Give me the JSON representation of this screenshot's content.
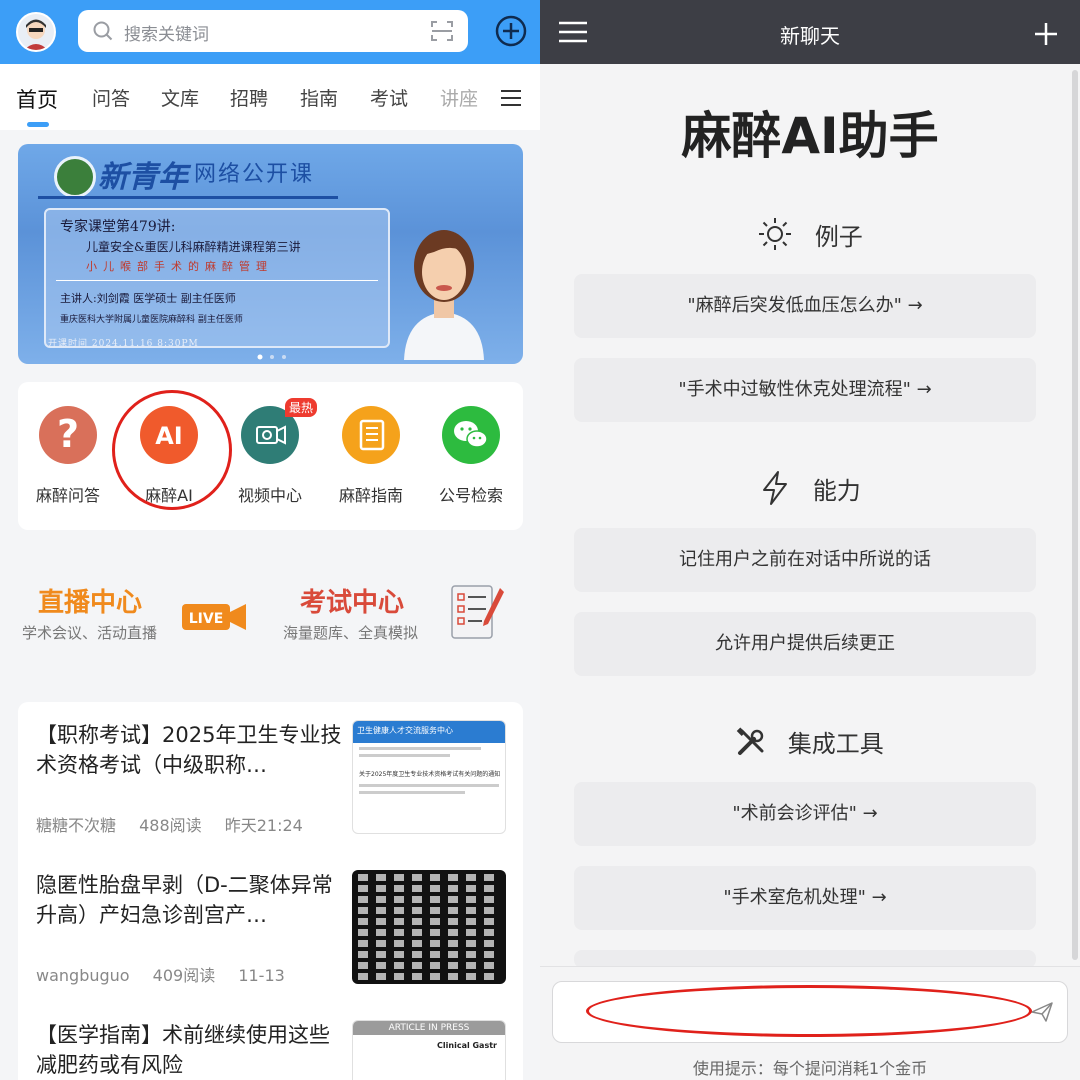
{
  "left": {
    "search_placeholder": "搜索关键词",
    "tabs": [
      {
        "label": "首页",
        "active": true
      },
      {
        "label": "问答"
      },
      {
        "label": "文库"
      },
      {
        "label": "招聘"
      },
      {
        "label": "指南"
      },
      {
        "label": "考试"
      },
      {
        "label": "讲座"
      }
    ],
    "banner": {
      "title": "新青年",
      "subtitle": "网络公开课",
      "line1": "专家课堂第479讲:",
      "line2": "儿童安全&重医儿科麻醉精进课程第三讲",
      "line3": "小儿喉部手术的麻醉管理",
      "speaker": "主讲人:刘剑霞      医学硕士      副主任医师",
      "affiliation": "重庆医科大学附属儿童医院麻醉科         副主任医师",
      "time": "开课时间 2024.11.16 8:30PM"
    },
    "shortcuts": [
      {
        "label": "麻醉问答",
        "icon": "question-icon",
        "color": "#d9705a"
      },
      {
        "label": "麻醉AI",
        "icon": "ai-icon",
        "color": "#f05a2c",
        "icon_text": "AI"
      },
      {
        "label": "视频中心",
        "icon": "video-icon",
        "color": "#2f7d76",
        "badge": "最热"
      },
      {
        "label": "麻醉指南",
        "icon": "book-icon",
        "color": "#f5a21b"
      },
      {
        "label": "公号检索",
        "icon": "wechat-icon",
        "color": "#2dbb3f"
      }
    ],
    "live": {
      "title": "直播中心",
      "subtitle": "学术会议、活动直播",
      "badge": "LIVE"
    },
    "exam": {
      "title": "考试中心",
      "subtitle": "海量题库、全真模拟"
    },
    "news": [
      {
        "title": "【职称考试】2025年卫生专业技术资格考试（中级职称…",
        "author": "糖糖不次糖",
        "reads": "488阅读",
        "time": "昨天21:24",
        "thumb_header": "卫生健康人才交流服务中心",
        "thumb_caption": "关于2025年度卫生专业技术资格考试有关问题的通知"
      },
      {
        "title": "隐匿性胎盘早剥（D-二聚体异常升高）产妇急诊剖宫产…",
        "author": "wangbuguo",
        "reads": "409阅读",
        "time": "11-13"
      },
      {
        "title": "【医学指南】术前继续使用这些减肥药或有风险",
        "thumb_header": "ARTICLE IN PRESS",
        "thumb_journal": "Clinical Gastr"
      }
    ]
  },
  "right": {
    "header_title": "新聊天",
    "title": "麻醉AI助手",
    "sections": [
      {
        "title": "例子",
        "icon": "sun-icon",
        "items": [
          "\"麻醉后突发低血压怎么办\" →",
          "\"手术中过敏性休克处理流程\" →"
        ]
      },
      {
        "title": "能力",
        "icon": "lightning-icon",
        "items": [
          "记住用户之前在对话中所说的话",
          "允许用户提供后续更正"
        ]
      },
      {
        "title": "集成工具",
        "icon": "tools-icon",
        "items": [
          "\"术前会诊评估\" →",
          "\"手术室危机处理\" →"
        ]
      }
    ],
    "hint": "使用提示：每个提问消耗1个金币"
  }
}
